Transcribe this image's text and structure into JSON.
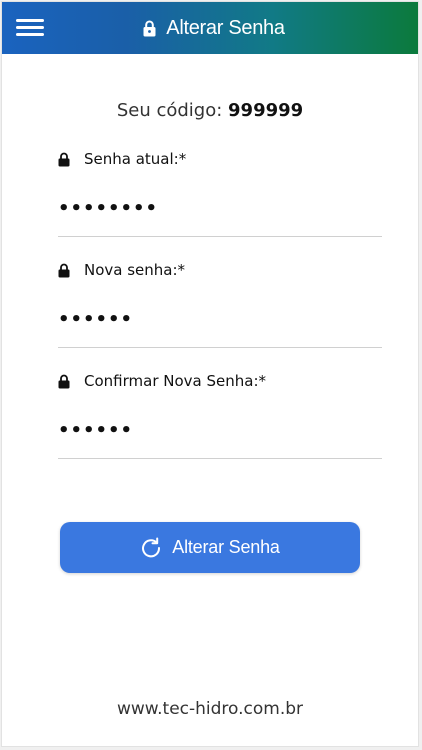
{
  "header": {
    "title": "Alterar Senha",
    "menu_icon": "hamburger-menu-icon",
    "title_icon": "lock-icon",
    "gradient_start": "#1a63bf",
    "gradient_end": "#0b7a3c"
  },
  "user_code": {
    "label": "Seu código:",
    "value": "999999"
  },
  "fields": [
    {
      "label": "Senha atual:*",
      "value": "••••••••",
      "icon": "lock-icon"
    },
    {
      "label": "Nova senha:*",
      "value": "••••••",
      "icon": "lock-icon"
    },
    {
      "label": "Confirmar Nova Senha:*",
      "value": "••••••",
      "icon": "lock-icon"
    }
  ],
  "submit": {
    "label": "Alterar Senha",
    "icon": "refresh-icon",
    "color": "#3a78e0"
  },
  "footer": {
    "website": "www.tec-hidro.com.br"
  }
}
